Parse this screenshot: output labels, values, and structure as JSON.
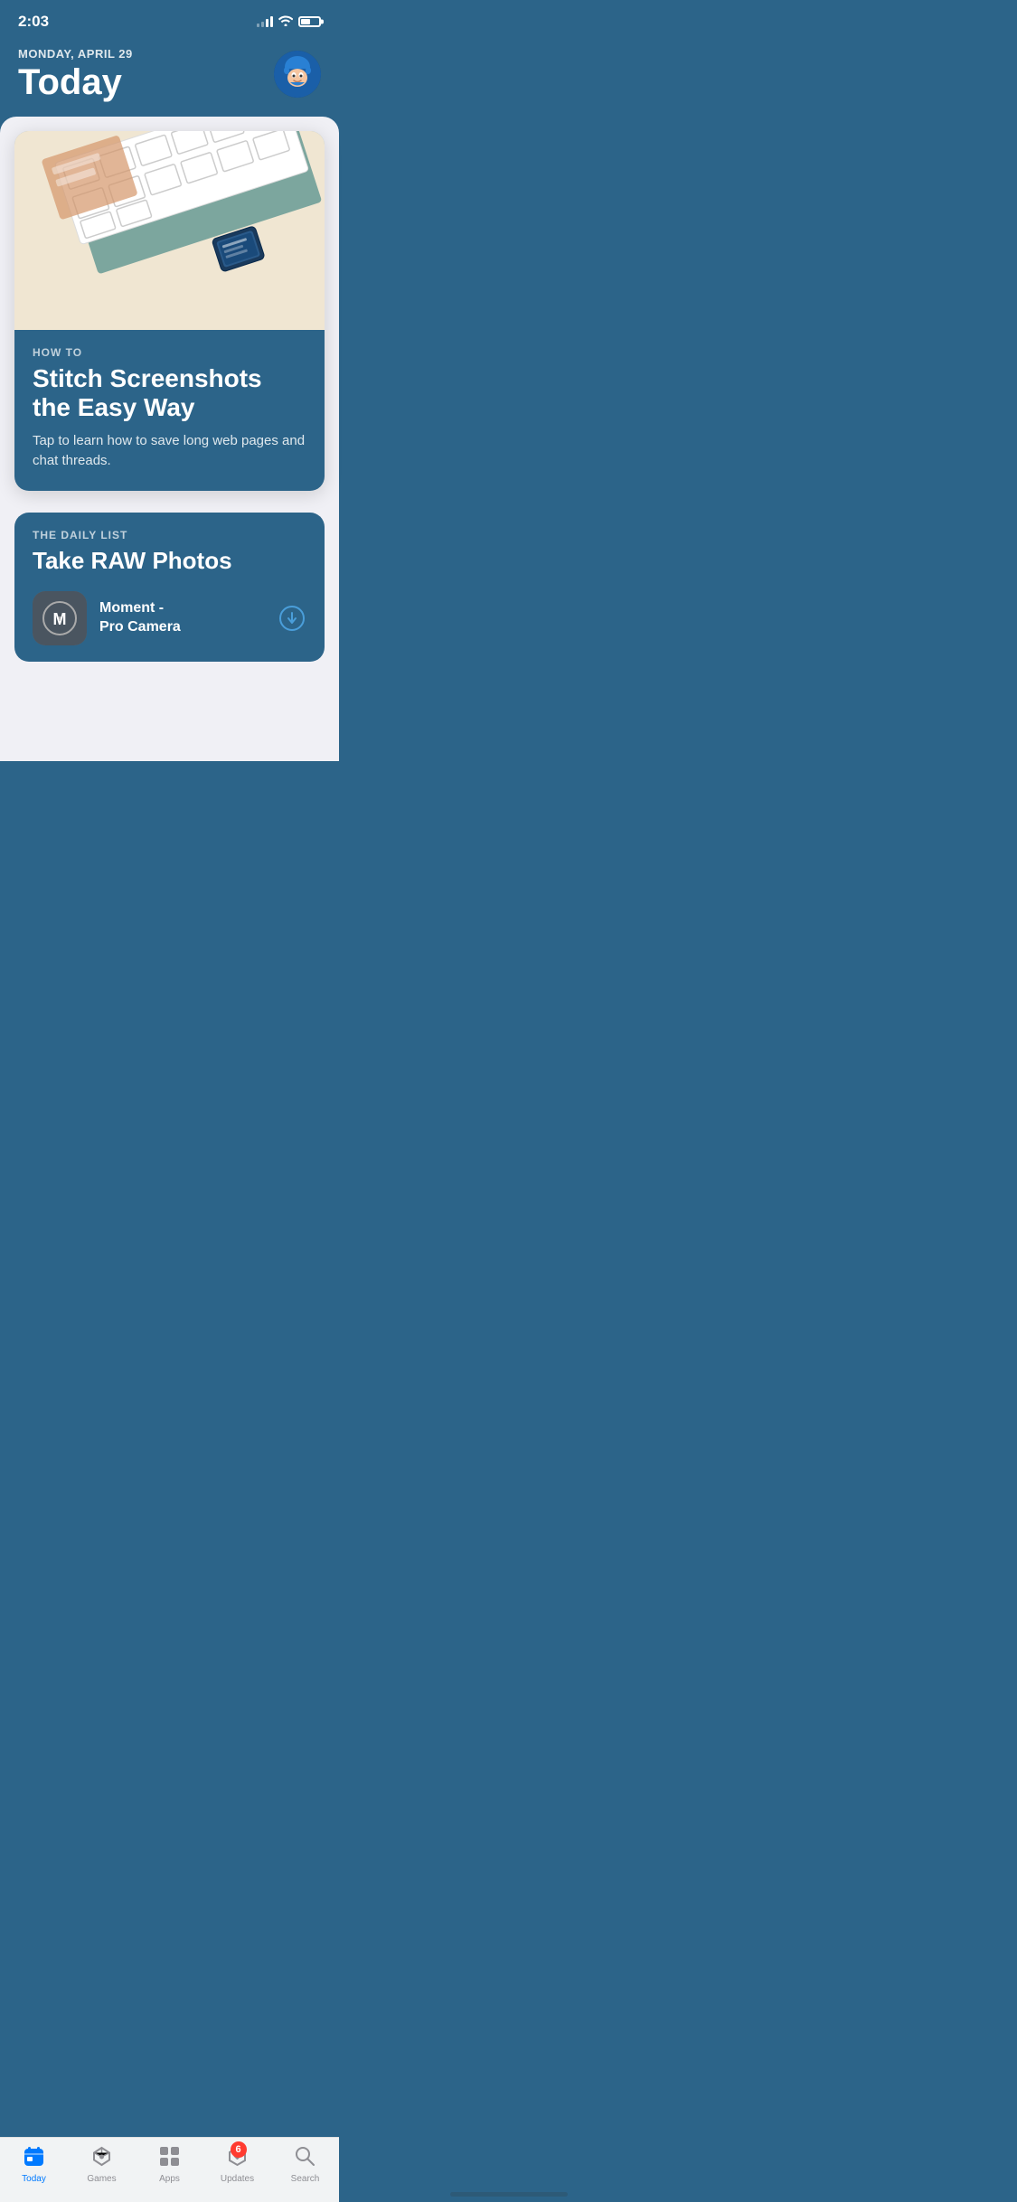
{
  "statusBar": {
    "time": "2:03"
  },
  "header": {
    "date": "Monday, April 29",
    "title": "Today"
  },
  "featureCard": {
    "eyebrow": "HOW TO",
    "headline": "Stitch Screenshots the Easy Way",
    "description": "Tap to learn how to save long web pages and chat threads."
  },
  "dailyList": {
    "eyebrow": "THE DAILY LIST",
    "title": "Take RAW Photos",
    "app": {
      "name": "Moment -\nPro Camera",
      "letter": "M"
    }
  },
  "tabBar": {
    "tabs": [
      {
        "id": "today",
        "label": "Today",
        "active": true
      },
      {
        "id": "games",
        "label": "Games",
        "active": false
      },
      {
        "id": "apps",
        "label": "Apps",
        "active": false
      },
      {
        "id": "updates",
        "label": "Updates",
        "active": false,
        "badge": "6"
      },
      {
        "id": "search",
        "label": "Search",
        "active": false
      }
    ]
  },
  "colors": {
    "primary": "#2c6489",
    "background": "#f0f0f5",
    "accent": "#007aff",
    "tabActive": "#007aff",
    "tabInactive": "#8e8e93"
  }
}
